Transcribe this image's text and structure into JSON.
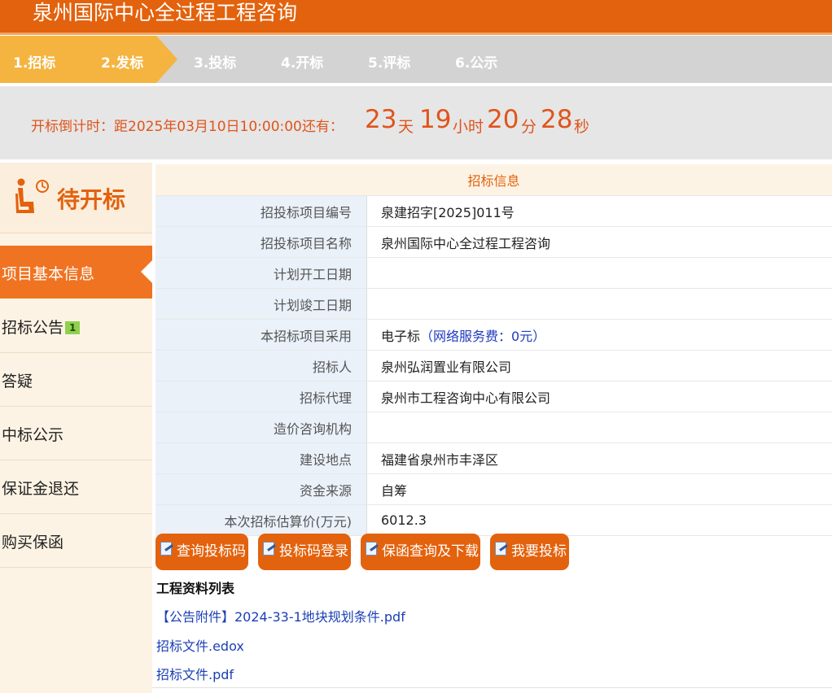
{
  "page": {
    "title": "泉州国际中心全过程工程咨询"
  },
  "steps": [
    {
      "label": "1.招标"
    },
    {
      "label": "2.发标"
    },
    {
      "label": "3.投标"
    },
    {
      "label": "4.开标"
    },
    {
      "label": "5.评标"
    },
    {
      "label": "6.公示"
    }
  ],
  "countdown": {
    "label": "开标倒计时：距2025年03月10日10:00:00还有：",
    "days": "23",
    "days_unit": "天",
    "hours": "19",
    "hours_unit": "小时",
    "minutes": "20",
    "minutes_unit": "分",
    "seconds": "28",
    "seconds_unit": "秒"
  },
  "sidebar": {
    "status": "待开标",
    "status_icon": "seated-person-clock-icon",
    "items": [
      {
        "label": "项目基本信息"
      },
      {
        "label": "招标公告",
        "badge": "1"
      },
      {
        "label": "答疑"
      },
      {
        "label": "中标公示"
      },
      {
        "label": "保证金退还"
      },
      {
        "label": "购买保函"
      }
    ]
  },
  "info": {
    "caption": "招标信息",
    "rows": [
      {
        "key": "招投标项目编号",
        "value": "泉建招字[2025]011号"
      },
      {
        "key": "招投标项目名称",
        "value": "泉州国际中心全过程工程咨询"
      },
      {
        "key": "计划开工日期",
        "value": ""
      },
      {
        "key": "计划竣工日期",
        "value": ""
      },
      {
        "key": "本招标项目采用",
        "value": "电子标",
        "note": "（网络服务费：0元）"
      },
      {
        "key": "招标人",
        "value": "泉州弘润置业有限公司"
      },
      {
        "key": "招标代理",
        "value": "泉州市工程咨询中心有限公司"
      },
      {
        "key": "造价咨询机构",
        "value": ""
      },
      {
        "key": "建设地点",
        "value": "福建省泉州市丰泽区"
      },
      {
        "key": "资金来源",
        "value": "自筹"
      },
      {
        "key": "本次招标估算价(万元)",
        "value": "6012.3"
      }
    ]
  },
  "buttons": [
    {
      "label": "查询投标码"
    },
    {
      "label": "投标码登录"
    },
    {
      "label": "保函查询及下载"
    },
    {
      "label": "我要投标"
    }
  ],
  "files": {
    "title": "工程资料列表",
    "items": [
      {
        "label": "【公告附件】2024-33-1地块规划条件.pdf"
      },
      {
        "label": "招标文件.edox"
      },
      {
        "label": "招标文件.pdf"
      }
    ]
  },
  "colors": {
    "brand_orange": "#e3620d",
    "step_done": "#f4b43f",
    "countdown_red": "#e0541b",
    "link_blue": "#1a3fb5"
  }
}
